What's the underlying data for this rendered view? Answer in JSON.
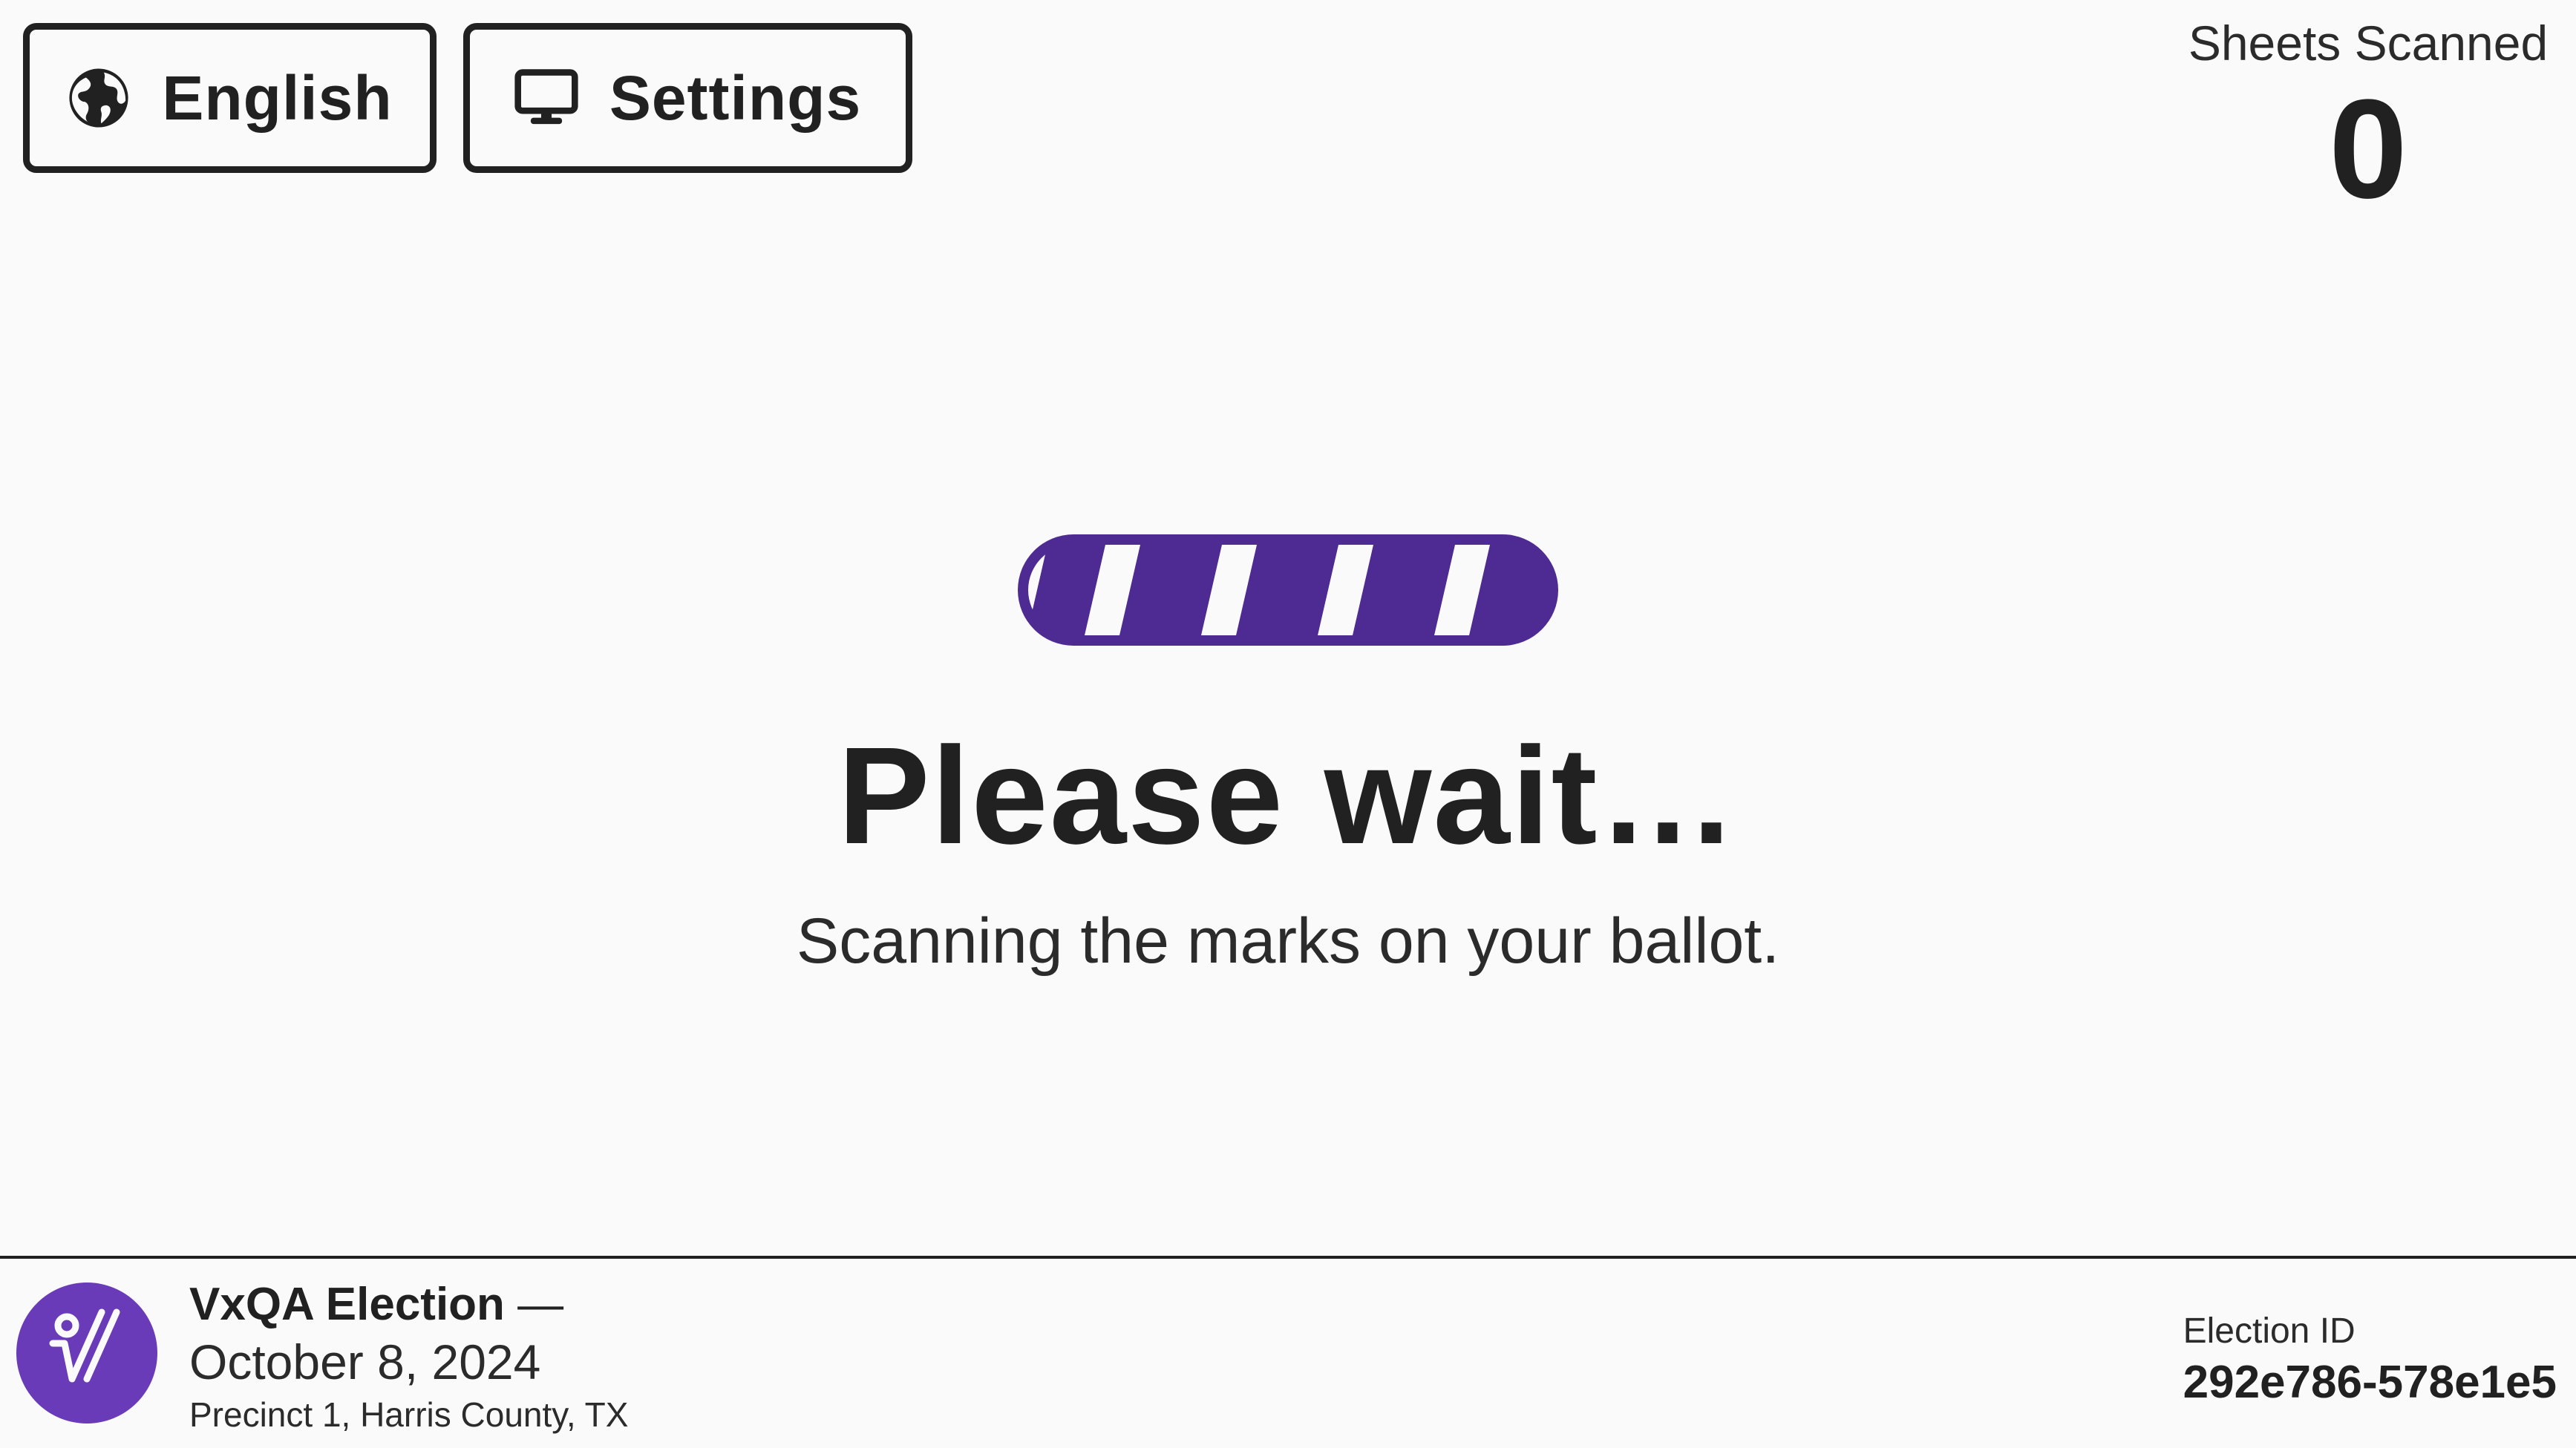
{
  "header": {
    "language_button": "English",
    "settings_button": "Settings",
    "sheets_scanned_label": "Sheets Scanned",
    "sheets_scanned_count": "0"
  },
  "main": {
    "headline": "Please wait…",
    "subtext": "Scanning the marks on your ballot."
  },
  "footer": {
    "election_title": "VxQA Election",
    "dash": " —",
    "election_date": "October 8, 2024",
    "precinct": "Precinct 1, Harris County, TX",
    "election_id_label": "Election ID",
    "election_id": "292e786-578e1e5"
  },
  "icons": {
    "language": "globe-icon",
    "settings": "monitor-icon",
    "seal": "vx-logo-icon"
  },
  "colors": {
    "accent": "#4e2a93",
    "seal": "#6a3bb8",
    "text": "#212121",
    "background": "#fafafa"
  }
}
